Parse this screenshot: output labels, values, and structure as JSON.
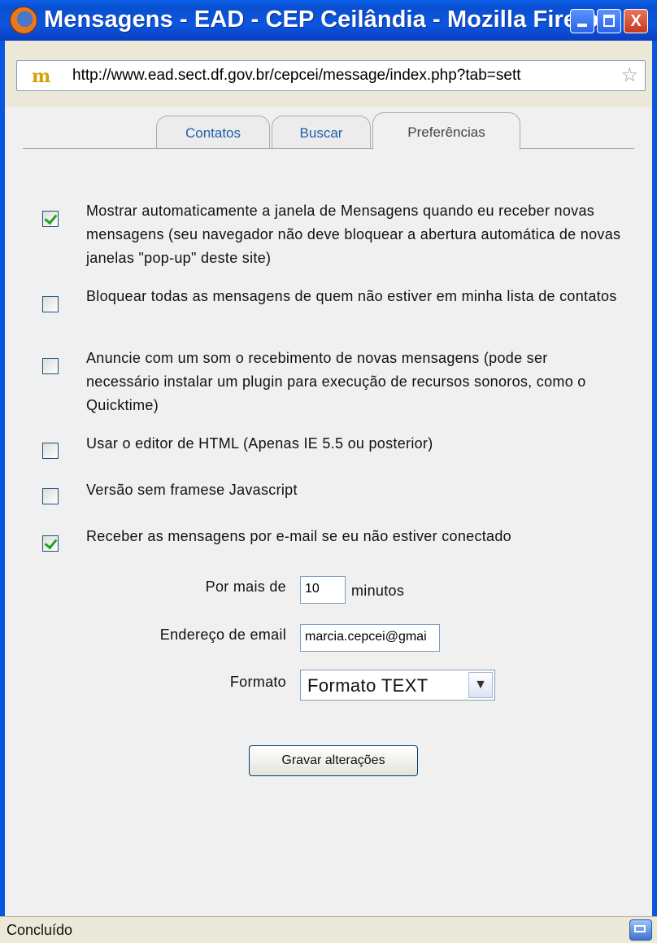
{
  "window": {
    "title": "Mensagens - EAD - CEP Ceilândia - Mozilla Firefox",
    "minimize_icon": "minimize-icon",
    "maximize_icon": "maximize-icon",
    "close_label": "X"
  },
  "address": {
    "url": "http://www.ead.sect.df.gov.br/cepcei/message/index.php?tab=sett",
    "favicon_text": "m"
  },
  "tabs": [
    {
      "label": "Contatos"
    },
    {
      "label": "Buscar"
    },
    {
      "label": "Preferências"
    }
  ],
  "options": [
    {
      "label": "Mostrar automaticamente a janela de Mensagens quando eu receber novas mensagens (seu navegador não deve bloquear a abertura automática de novas janelas \"pop-up\" deste site)",
      "checked": true
    },
    {
      "label": "Bloquear todas as mensagens de quem não estiver em minha lista de contatos",
      "checked": false
    },
    {
      "label": "Anuncie com um som o recebimento de novas mensagens (pode ser necessário instalar um plugin para execução de recursos sonoros, como o Quicktime)",
      "checked": false
    },
    {
      "label": "Usar o editor de HTML (Apenas IE 5.5 ou posterior)",
      "checked": false
    },
    {
      "label": "Versão sem framese Javascript",
      "checked": false
    },
    {
      "label": "Receber as mensagens por e-mail se eu não estiver conectado",
      "checked": true
    }
  ],
  "email_settings": {
    "minutes_label": "Por mais de",
    "minutes_value": "10",
    "minutes_unit": "minutos",
    "email_label": "Endereço de email",
    "email_value": "marcia.cepcei@gmai",
    "format_label": "Formato",
    "format_value": "Formato TEXT"
  },
  "save_button": "Gravar alterações",
  "status": {
    "text": "Concluído"
  }
}
